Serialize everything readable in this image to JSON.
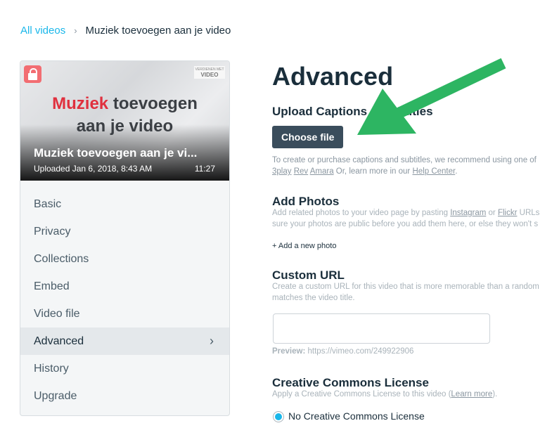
{
  "breadcrumb": {
    "parent": "All videos",
    "separator": "›",
    "current": "Muziek toevoegen aan je video"
  },
  "video": {
    "art_red": "Muziek",
    "art_rest": "toevoegen",
    "art_line2": "aan je video",
    "brand_small": "VERDIENEN MET",
    "brand_big": "VIDEO",
    "title": "Muziek toevoegen aan je vi...",
    "uploaded": "Uploaded Jan 6, 2018, 8:43 AM",
    "duration": "11:27",
    "lock_icon": "lock-icon"
  },
  "sidebar": {
    "items": [
      {
        "label": "Basic"
      },
      {
        "label": "Privacy"
      },
      {
        "label": "Collections"
      },
      {
        "label": "Embed"
      },
      {
        "label": "Video file"
      },
      {
        "label": "Advanced",
        "active": true
      },
      {
        "label": "History"
      },
      {
        "label": "Upgrade"
      }
    ],
    "chevron": "›"
  },
  "main": {
    "title": "Advanced",
    "captions": {
      "heading": "Upload Captions & Subtitles",
      "button": "Choose file",
      "help1": "To create or purchase captions and subtitles, we recommend using one of",
      "link1": "3play",
      "link2": "Rev",
      "link3": "Amara",
      "help2": "Or, learn more in our",
      "help_link": "Help Center",
      "help_end": "."
    },
    "photos": {
      "heading": "Add Photos",
      "help1": "Add related photos to your video page by pasting",
      "link1": "Instagram",
      "or": "or",
      "link2": "Flickr",
      "help1b": "URLs",
      "help2": "sure your photos are public before you add them here, or else they won't s",
      "add": "+ Add a new photo"
    },
    "custom_url": {
      "heading": "Custom URL",
      "help1": "Create a custom URL for this video that is more memorable than a random",
      "help2": "matches the video title.",
      "value": "",
      "preview_label": "Preview:",
      "preview_url": "https://vimeo.com/249922906"
    },
    "cc": {
      "heading": "Creative Commons License",
      "help": "Apply a Creative Commons License to this video (",
      "link": "Learn more",
      "help_end": ").",
      "option": "No Creative Commons License"
    }
  },
  "colors": {
    "accent": "#1ab7ea",
    "button": "#3a4d5c",
    "annotation_arrow": "#2db562"
  }
}
